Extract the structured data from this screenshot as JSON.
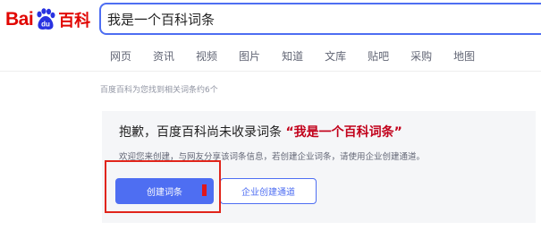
{
  "logo": {
    "text_left": "Bai",
    "text_paw": "du",
    "text_right": "百科"
  },
  "search": {
    "query": "我是一个百科词条"
  },
  "nav": {
    "tabs": [
      "网页",
      "资讯",
      "视频",
      "图片",
      "知道",
      "文库",
      "贴吧",
      "采购",
      "地图"
    ]
  },
  "result_count": "百度百科为您找到相关词条约6个",
  "notice": {
    "apology_prefix": "抱歉，百度百科尚未收录词条",
    "term": "“我是一个百科词条”",
    "description": "欢迎您来创建，与网友分享该词条信息，若创建企业词条，请使用企业创建通道。"
  },
  "buttons": {
    "create": "创建词条",
    "enterprise": "企业创建通道"
  },
  "colors": {
    "brand_red": "#e10602",
    "accent_blue": "#4e6ef2",
    "term_red": "#c2001a",
    "annotation_red": "#e1251b"
  }
}
